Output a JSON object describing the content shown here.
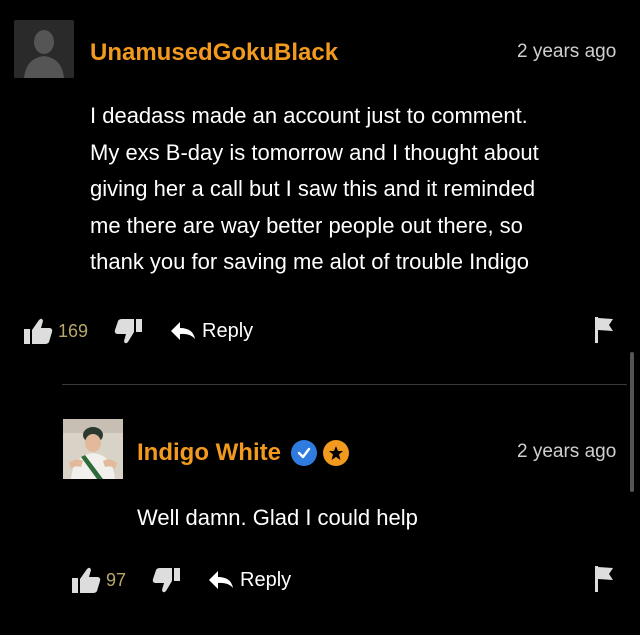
{
  "comment": {
    "username": "UnamusedGokuBlack",
    "timestamp": "2 years ago",
    "lines": [
      "I deadass made an account just to comment.",
      "My exs B-day is tomorrow and I thought about",
      "giving her a call but I saw this and it reminded",
      "me there are way better people out there, so",
      "thank you for saving me alot of trouble Indigo"
    ],
    "likes": "169",
    "reply_label": "Reply"
  },
  "reply": {
    "username": "Indigo White",
    "timestamp": "2 years ago",
    "text": "Well damn. Glad I could help",
    "likes": "97",
    "reply_label": "Reply"
  },
  "colors": {
    "username": "#f29a1f",
    "background": "#000000",
    "verified": "#2f7be0",
    "star_badge": "#f29a1f",
    "count": "#b9a76a"
  },
  "icons": [
    "default-avatar-icon",
    "thumbs-up-icon",
    "thumbs-down-icon",
    "reply-arrow-icon",
    "flag-icon",
    "verified-check-icon",
    "star-badge-icon"
  ]
}
